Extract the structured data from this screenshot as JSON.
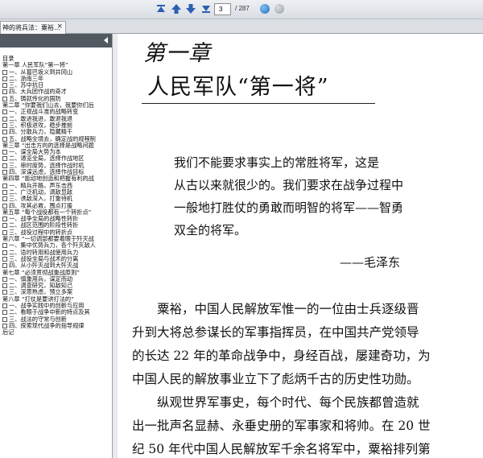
{
  "toolbar": {
    "page_current": "3",
    "page_total": "/ 287",
    "icons": [
      "first-page-icon",
      "prev-page-icon",
      "next-page-icon",
      "last-page-icon",
      "go-icon",
      "stop-icon"
    ]
  },
  "tab": {
    "label": "神的将兵法：粟裕...",
    "close": "×"
  },
  "sidebar": {
    "items": [
      {
        "text": "目录",
        "box": false
      },
      {
        "text": "第一章 人民军队“第一将”",
        "box": false
      },
      {
        "text": "一、从葛巴坂义到井冈山",
        "box": true
      },
      {
        "text": "二、浙南三年",
        "box": true
      },
      {
        "text": "三、苏中抗日",
        "box": true
      },
      {
        "text": "四、大兵团作战的奇才",
        "box": true
      },
      {
        "text": "五、铸就传化的国防",
        "box": true
      },
      {
        "text": "第二章 “你要我们山去，我要你们后",
        "box": false
      },
      {
        "text": "一、正视战斗准的战略转变",
        "box": true
      },
      {
        "text": "二、敢进我进，敢退我退",
        "box": true
      },
      {
        "text": "三、积极进攻，稳步推前",
        "box": true
      },
      {
        "text": "四、分散兵力，隐藏精干",
        "box": true
      },
      {
        "text": "五、战略全境去，确定战的规程制",
        "box": true
      },
      {
        "text": "第三章 “出击方向的选择是战略问题",
        "box": false
      },
      {
        "text": "一、谋全局大势为本",
        "box": true
      },
      {
        "text": "二、通览全局，选择作战地区",
        "box": true
      },
      {
        "text": "三、审时度势，选择作战时机",
        "box": true
      },
      {
        "text": "四、深谋远虑，选择作战目标",
        "box": true
      },
      {
        "text": "第四章 “能动地创造和把握有利的战",
        "box": false
      },
      {
        "text": "一、精兵开路，声东击西",
        "box": true
      },
      {
        "text": "二、广泛机动，调敌显敌",
        "box": true
      },
      {
        "text": "三、诱敌深入，打重待机",
        "box": true
      },
      {
        "text": "四、攻其必救，围点打援",
        "box": true
      },
      {
        "text": "第五章 “每个战役都有一个转折点”",
        "box": false
      },
      {
        "text": "一、战争全局的战略性转折",
        "box": true
      },
      {
        "text": "二、战区范围的阶段性转折",
        "box": true
      },
      {
        "text": "三、战役过程中的转折点",
        "box": true
      },
      {
        "text": "第六章 “一切调部都要着眼于歼灭战",
        "box": false
      },
      {
        "text": "一、集中优势兵力，各个歼灭敌人",
        "box": true
      },
      {
        "text": "二、适时转用和战使用兵力",
        "box": true
      },
      {
        "text": "三、战役全局与战术的分离",
        "box": true
      },
      {
        "text": "四、从小歼灭战到大歼灭战",
        "box": true
      },
      {
        "text": "第七章 “必须贯彻战重战原则”",
        "box": false
      },
      {
        "text": "一、慎重用兵，谋定而动",
        "box": true
      },
      {
        "text": "二、调查研究，知敌知己",
        "box": true
      },
      {
        "text": "三、深思熟虑，预立多案",
        "box": true
      },
      {
        "text": "第八章 “打仗是要讲打法的”",
        "box": false
      },
      {
        "text": "一、战争实践中的创新与应用",
        "box": true
      },
      {
        "text": "二、看眼于战争中新的特点及其",
        "box": true
      },
      {
        "text": "三、战法的守常与创新",
        "box": true
      },
      {
        "text": "四、探索现代战争的指导规律",
        "box": true
      },
      {
        "text": "后记",
        "box": false
      }
    ]
  },
  "document": {
    "chapter_num": "第一章",
    "chapter_title": "人民军队“第一将”",
    "quote_lines": [
      "我们不能要求事实上的常胜将军，这是",
      "从古以来就很少的。我们要求在战争过程中",
      "一般地打胜仗的勇敢而明智的将军——智勇",
      "双全的将军。"
    ],
    "quote_author": "——毛泽东",
    "body_lines": [
      "　　粟裕，中国人民解放军惟一的一位由士兵逐级晋",
      "升到大将总参谋长的军事指挥员，在中国共产党领导",
      "的长达 22 年的革命战争中，身经百战，屡建奇功，为",
      "中国人民的解放事业立下了彪炳千古的历史性功勋。",
      "　　纵观世界军事史，每个时代、每个民族都曾造就",
      "出一批声名显赫、永垂史册的军事家和将帅。在 20 世",
      "纪 50 年代中国人民解放军千余名将军中，粟裕排列第"
    ]
  }
}
